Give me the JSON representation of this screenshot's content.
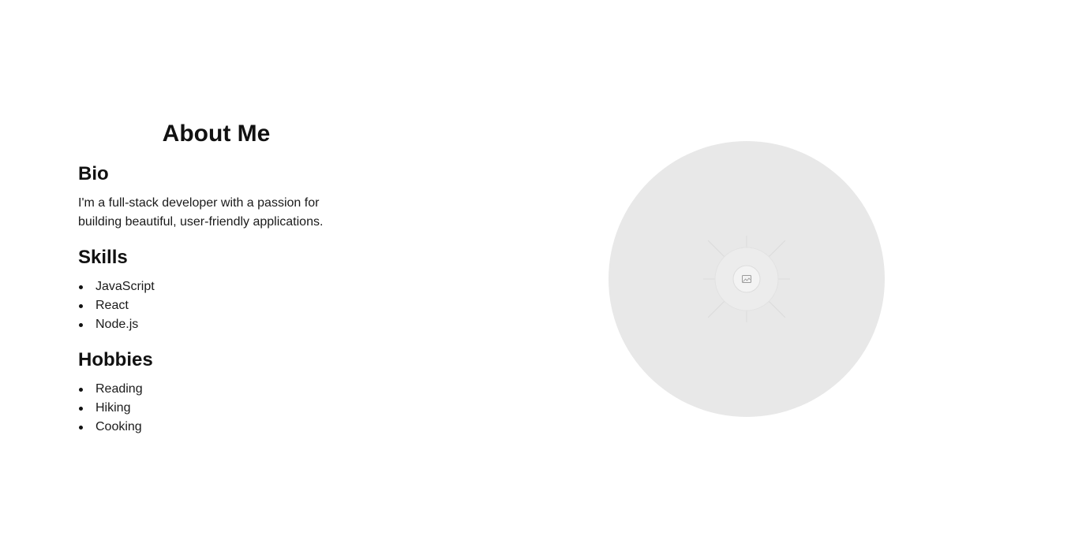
{
  "about": {
    "title": "About Me",
    "bio": {
      "heading": "Bio",
      "text": "I'm a full-stack developer with a passion for building beautiful, user-friendly applications."
    },
    "skills": {
      "heading": "Skills",
      "items": [
        "JavaScript",
        "React",
        "Node.js"
      ]
    },
    "hobbies": {
      "heading": "Hobbies",
      "items": [
        "Reading",
        "Hiking",
        "Cooking"
      ]
    }
  },
  "profile_image": {
    "icon": "image-placeholder-icon",
    "background_color": "#e8e8e8"
  }
}
